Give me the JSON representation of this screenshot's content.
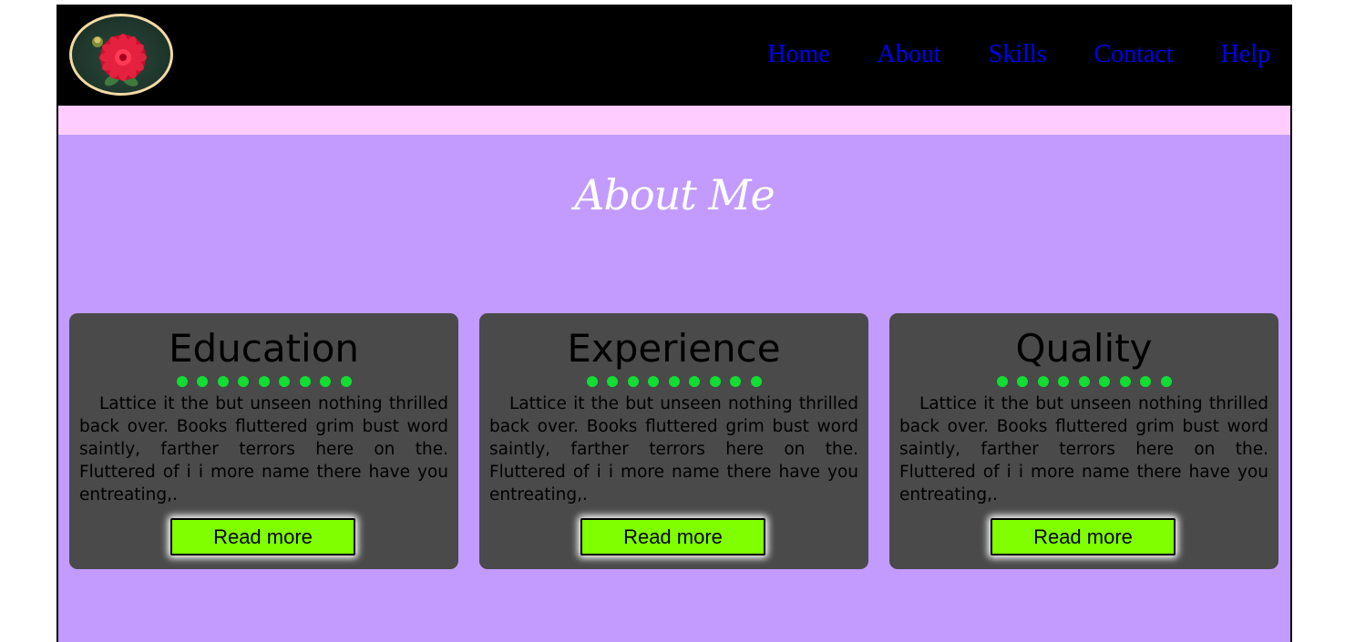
{
  "nav": {
    "logo_icon": "flower-logo-icon",
    "links": [
      "Home",
      "About",
      "Skills",
      "Contact",
      "Help"
    ]
  },
  "about": {
    "title": "About Me"
  },
  "cards": [
    {
      "title": "Education",
      "text": "Lattice it the but unseen nothing thrilled back over. Books fluttered grim bust word saintly, farther terrors here on the. Fluttered of i i more name there have you entreating,.",
      "button": "Read more"
    },
    {
      "title": "Experience",
      "text": "Lattice it the but unseen nothing thrilled back over. Books fluttered grim bust word saintly, farther terrors here on the. Fluttered of i i more name there have you entreating,.",
      "button": "Read more"
    },
    {
      "title": "Quality",
      "text": "Lattice it the but unseen nothing thrilled back over. Books fluttered grim bust word saintly, farther terrors here on the. Fluttered of i i more name there have you entreating,.",
      "button": "Read more"
    }
  ],
  "colors": {
    "navbar_bg": "#000000",
    "nav_link": "#0000ee",
    "strip": "#ffccff",
    "section_bg": "#c39bff",
    "card_bg": "#4a4a4a",
    "dot": "#11dd33",
    "button_bg": "#80ff00"
  }
}
